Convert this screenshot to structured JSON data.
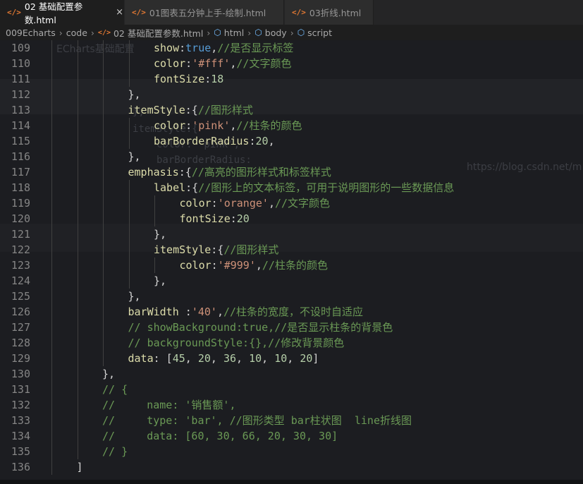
{
  "tabs": [
    {
      "label": "02 基础配置参数.html",
      "close": "×"
    },
    {
      "label": "01图表五分钟上手-绘制.html"
    },
    {
      "label": "03折线.html"
    }
  ],
  "tab_icon": "</>",
  "breadcrumb": {
    "items": [
      "009Echarts",
      "code",
      "02 基础配置参数.html",
      "html",
      "body",
      "script"
    ],
    "separator": "›"
  },
  "icons": [
    "html-file-icon",
    "cube-icon",
    "close-icon"
  ],
  "lines": [
    {
      "num": "109",
      "indent": 5,
      "tokens": [
        [
          "k",
          "show"
        ],
        [
          "p",
          ":"
        ],
        [
          "b",
          "true"
        ],
        [
          "p",
          ","
        ],
        [
          "c",
          "//是否显示标签"
        ]
      ]
    },
    {
      "num": "110",
      "indent": 5,
      "tokens": [
        [
          "k",
          "color"
        ],
        [
          "p",
          ":"
        ],
        [
          "s",
          "'#fff'"
        ],
        [
          "p",
          ","
        ],
        [
          "c",
          "//文字颜色"
        ]
      ]
    },
    {
      "num": "111",
      "indent": 5,
      "tokens": [
        [
          "k",
          "fontSize"
        ],
        [
          "p",
          ":"
        ],
        [
          "n",
          "18"
        ]
      ]
    },
    {
      "num": "112",
      "indent": 4,
      "tokens": [
        [
          "p",
          "},"
        ]
      ]
    },
    {
      "num": "113",
      "indent": 4,
      "tokens": [
        [
          "k",
          "itemStyle"
        ],
        [
          "p",
          ":{"
        ],
        [
          "c",
          "//图形样式"
        ]
      ]
    },
    {
      "num": "114",
      "indent": 5,
      "tokens": [
        [
          "k",
          "color"
        ],
        [
          "p",
          ":"
        ],
        [
          "s",
          "'pink'"
        ],
        [
          "p",
          ","
        ],
        [
          "c",
          "//柱条的颜色"
        ]
      ]
    },
    {
      "num": "115",
      "indent": 5,
      "tokens": [
        [
          "k",
          "barBorderRadius"
        ],
        [
          "p",
          ":"
        ],
        [
          "n",
          "20"
        ],
        [
          "p",
          ","
        ]
      ]
    },
    {
      "num": "116",
      "indent": 4,
      "tokens": [
        [
          "p",
          "},"
        ]
      ]
    },
    {
      "num": "117",
      "indent": 4,
      "tokens": [
        [
          "k",
          "emphasis"
        ],
        [
          "p",
          ":{"
        ],
        [
          "c",
          "//高亮的图形样式和标签样式"
        ]
      ]
    },
    {
      "num": "118",
      "indent": 5,
      "tokens": [
        [
          "k",
          "label"
        ],
        [
          "p",
          ":{"
        ],
        [
          "c",
          "//图形上的文本标签，可用于说明图形的一些数据信息"
        ]
      ]
    },
    {
      "num": "119",
      "indent": 6,
      "tokens": [
        [
          "k",
          "color"
        ],
        [
          "p",
          ":"
        ],
        [
          "s",
          "'orange'"
        ],
        [
          "p",
          ","
        ],
        [
          "c",
          "//文字颜色"
        ]
      ]
    },
    {
      "num": "120",
      "indent": 6,
      "tokens": [
        [
          "k",
          "fontSize"
        ],
        [
          "p",
          ":"
        ],
        [
          "n",
          "20"
        ]
      ]
    },
    {
      "num": "121",
      "indent": 5,
      "tokens": [
        [
          "p",
          "},"
        ]
      ]
    },
    {
      "num": "122",
      "indent": 5,
      "tokens": [
        [
          "k",
          "itemStyle"
        ],
        [
          "p",
          ":{"
        ],
        [
          "c",
          "//图形样式"
        ]
      ]
    },
    {
      "num": "123",
      "indent": 6,
      "tokens": [
        [
          "k",
          "color"
        ],
        [
          "p",
          ":"
        ],
        [
          "s",
          "'#999'"
        ],
        [
          "p",
          ","
        ],
        [
          "c",
          "//柱条的颜色"
        ]
      ]
    },
    {
      "num": "124",
      "indent": 5,
      "tokens": [
        [
          "p",
          "},"
        ]
      ]
    },
    {
      "num": "125",
      "indent": 4,
      "tokens": [
        [
          "p",
          "},"
        ]
      ]
    },
    {
      "num": "126",
      "indent": 4,
      "tokens": [
        [
          "k",
          "barWidth "
        ],
        [
          "p",
          ":"
        ],
        [
          "s",
          "'40'"
        ],
        [
          "p",
          ","
        ],
        [
          "c",
          "//柱条的宽度，不设时自适应"
        ]
      ]
    },
    {
      "num": "127",
      "indent": 4,
      "tokens": [
        [
          "c",
          "// showBackground:true,//是否显示柱条的背景色"
        ]
      ]
    },
    {
      "num": "128",
      "indent": 4,
      "tokens": [
        [
          "c",
          "// backgroundStyle:{},//修改背景颜色"
        ]
      ]
    },
    {
      "num": "129",
      "indent": 4,
      "tokens": [
        [
          "k",
          "data"
        ],
        [
          "p",
          ": ["
        ],
        [
          "n",
          "45"
        ],
        [
          "p",
          ", "
        ],
        [
          "n",
          "20"
        ],
        [
          "p",
          ", "
        ],
        [
          "n",
          "36"
        ],
        [
          "p",
          ", "
        ],
        [
          "n",
          "10"
        ],
        [
          "p",
          ", "
        ],
        [
          "n",
          "10"
        ],
        [
          "p",
          ", "
        ],
        [
          "n",
          "20"
        ],
        [
          "p",
          "]"
        ]
      ]
    },
    {
      "num": "130",
      "indent": 3,
      "tokens": [
        [
          "p",
          "},"
        ]
      ]
    },
    {
      "num": "131",
      "indent": 3,
      "tokens": [
        [
          "c",
          "// {"
        ]
      ]
    },
    {
      "num": "132",
      "indent": 3,
      "tokens": [
        [
          "c",
          "//     name: '销售额',"
        ]
      ]
    },
    {
      "num": "133",
      "indent": 3,
      "tokens": [
        [
          "c",
          "//     type: 'bar', //图形类型 bar柱状图  line折线图"
        ]
      ]
    },
    {
      "num": "134",
      "indent": 3,
      "tokens": [
        [
          "c",
          "//     data: [60, 30, 66, 20, 30, 30]"
        ]
      ]
    },
    {
      "num": "135",
      "indent": 3,
      "tokens": [
        [
          "c",
          "// }"
        ]
      ]
    },
    {
      "num": "136",
      "indent": 2,
      "tokens": [
        [
          "p",
          "]"
        ]
      ]
    }
  ],
  "background_ghost": {
    "title": "ECharts基础配置",
    "watermark": "https://blog.csdn.net/m",
    "ghost_code": [
      "},",
      "itemStyle:{",
      "color: 'pink',",
      "barBorderRadius:"
    ]
  }
}
